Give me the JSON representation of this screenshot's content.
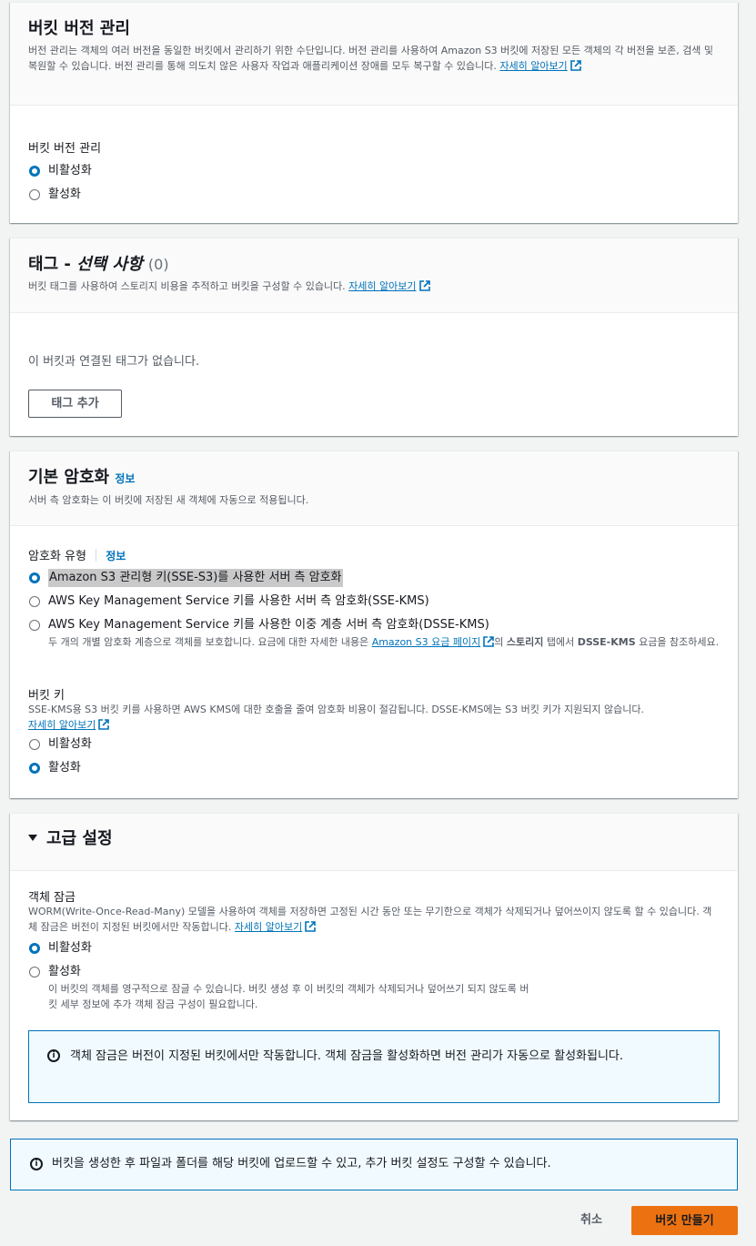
{
  "versioning": {
    "title": "버킷 버전 관리",
    "description": "버전 관리는 객체의 여러 버전을 동일한 버킷에서 관리하기 위한 수단입니다. 버전 관리를 사용하여 Amazon S3 버킷에 저장된 모든 객체의 각 버전을 보존, 검색 및 복원할 수 있습니다. 버전 관리를 통해 의도치 않은 사용자 작업과 애플리케이션 장애를 모두 복구할 수 있습니다.",
    "learn_more": "자세히 알아보기",
    "field_label": "버킷 버전 관리",
    "options": [
      "비활성화",
      "활성화"
    ],
    "selected": "비활성화"
  },
  "tags": {
    "title": "태그 - ",
    "title_italic": "선택 사항",
    "count": "(0)",
    "description": "버킷 태그를 사용하여 스토리지 비용을 추적하고 버킷을 구성할 수 있습니다.",
    "learn_more": "자세히 알아보기",
    "empty_text": "이 버킷과 연결된 태그가 없습니다.",
    "add_button": "태그 추가"
  },
  "encryption": {
    "title": "기본 암호화",
    "info": "정보",
    "description": "서버 측 암호화는 이 버킷에 저장된 새 객체에 자동으로 적용됩니다.",
    "type_label": "암호화 유형",
    "type_info": "정보",
    "options": [
      "Amazon S3 관리형 키(SSE-S3)를 사용한 서버 측 암호화",
      "AWS Key Management Service 키를 사용한 서버 측 암호화(SSE-KMS)",
      "AWS Key Management Service 키를 사용한 이중 계층 서버 측 암호화(DSSE-KMS)"
    ],
    "selected": "Amazon S3 관리형 키(SSE-S3)를 사용한 서버 측 암호화",
    "dsse_desc_1": "두 개의 개별 암호화 계층으로 객체를 보호합니다. 요금에 대한 자세한 내용은 ",
    "dsse_link": "Amazon S3 요금 페이지",
    "dsse_desc_2": "의 ",
    "dsse_bold_1": "스토리지",
    "dsse_desc_3": " 탭에서 ",
    "dsse_bold_2": "DSSE-KMS",
    "dsse_desc_4": " 요금을 참조하세요.",
    "bucket_key_label": "버킷 키",
    "bucket_key_desc": "SSE-KMS용 S3 버킷 키를 사용하면 AWS KMS에 대한 호출을 줄여 암호화 비용이 절감됩니다. DSSE-KMS에는 S3 버킷 키가 지원되지 않습니다.",
    "bucket_key_learn_more": "자세히 알아보기",
    "bucket_key_options": [
      "비활성화",
      "활성화"
    ],
    "bucket_key_selected": "활성화"
  },
  "advanced": {
    "title": "고급 설정",
    "object_lock_label": "객체 잠금",
    "object_lock_desc": "WORM(Write-Once-Read-Many) 모델을 사용하여 객체를 저장하면 고정된 시간 동안 또는 무기한으로 객체가 삭제되거나 덮어쓰이지 않도록 할 수 있습니다. 객체 잠금은 버전이 지정된 버킷에서만 작동합니다.",
    "learn_more": "자세히 알아보기",
    "options": [
      "비활성화",
      "활성화"
    ],
    "selected": "비활성화",
    "enable_desc": "이 버킷의 객체를 영구적으로 잠글 수 있습니다. 버킷 생성 후 이 버킷의 객체가 삭제되거나 덮어쓰기 되지 않도록 버킷 세부 정보에 추가 객체 잠금 구성이 필요합니다.",
    "alert": "객체 잠금은 버전이 지정된 버킷에서만 작동합니다. 객체 잠금을 활성화하면 버전 관리가 자동으로 활성화됩니다."
  },
  "footer": {
    "alert": "버킷을 생성한 후 파일과 폴더를 해당 버킷에 업로드할 수 있고, 추가 버킷 설정도 구성할 수 있습니다.",
    "cancel": "취소",
    "create": "버킷 만들기"
  },
  "colors": {
    "primary_button": "#ec7211",
    "link": "#0073bb",
    "alert_bg": "#f1faff"
  }
}
